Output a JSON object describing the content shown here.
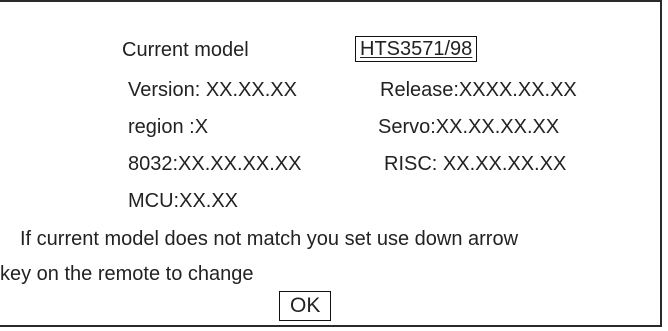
{
  "dialog": {
    "current_model_label": "Current model",
    "current_model_value": "HTS3571/98",
    "version": "Version: XX.XX.XX",
    "release": "Release:XXXX.XX.XX",
    "region": "region :X",
    "servo": "Servo:XX.XX.XX.XX",
    "chip_8032": "8032:XX.XX.XX.XX",
    "risc": "RISC: XX.XX.XX.XX",
    "mcu": "MCU:XX.XX",
    "instruction_line1": "If current model does not match you set use down arrow",
    "instruction_line2": "key on the remote to change",
    "ok_label": "OK"
  }
}
